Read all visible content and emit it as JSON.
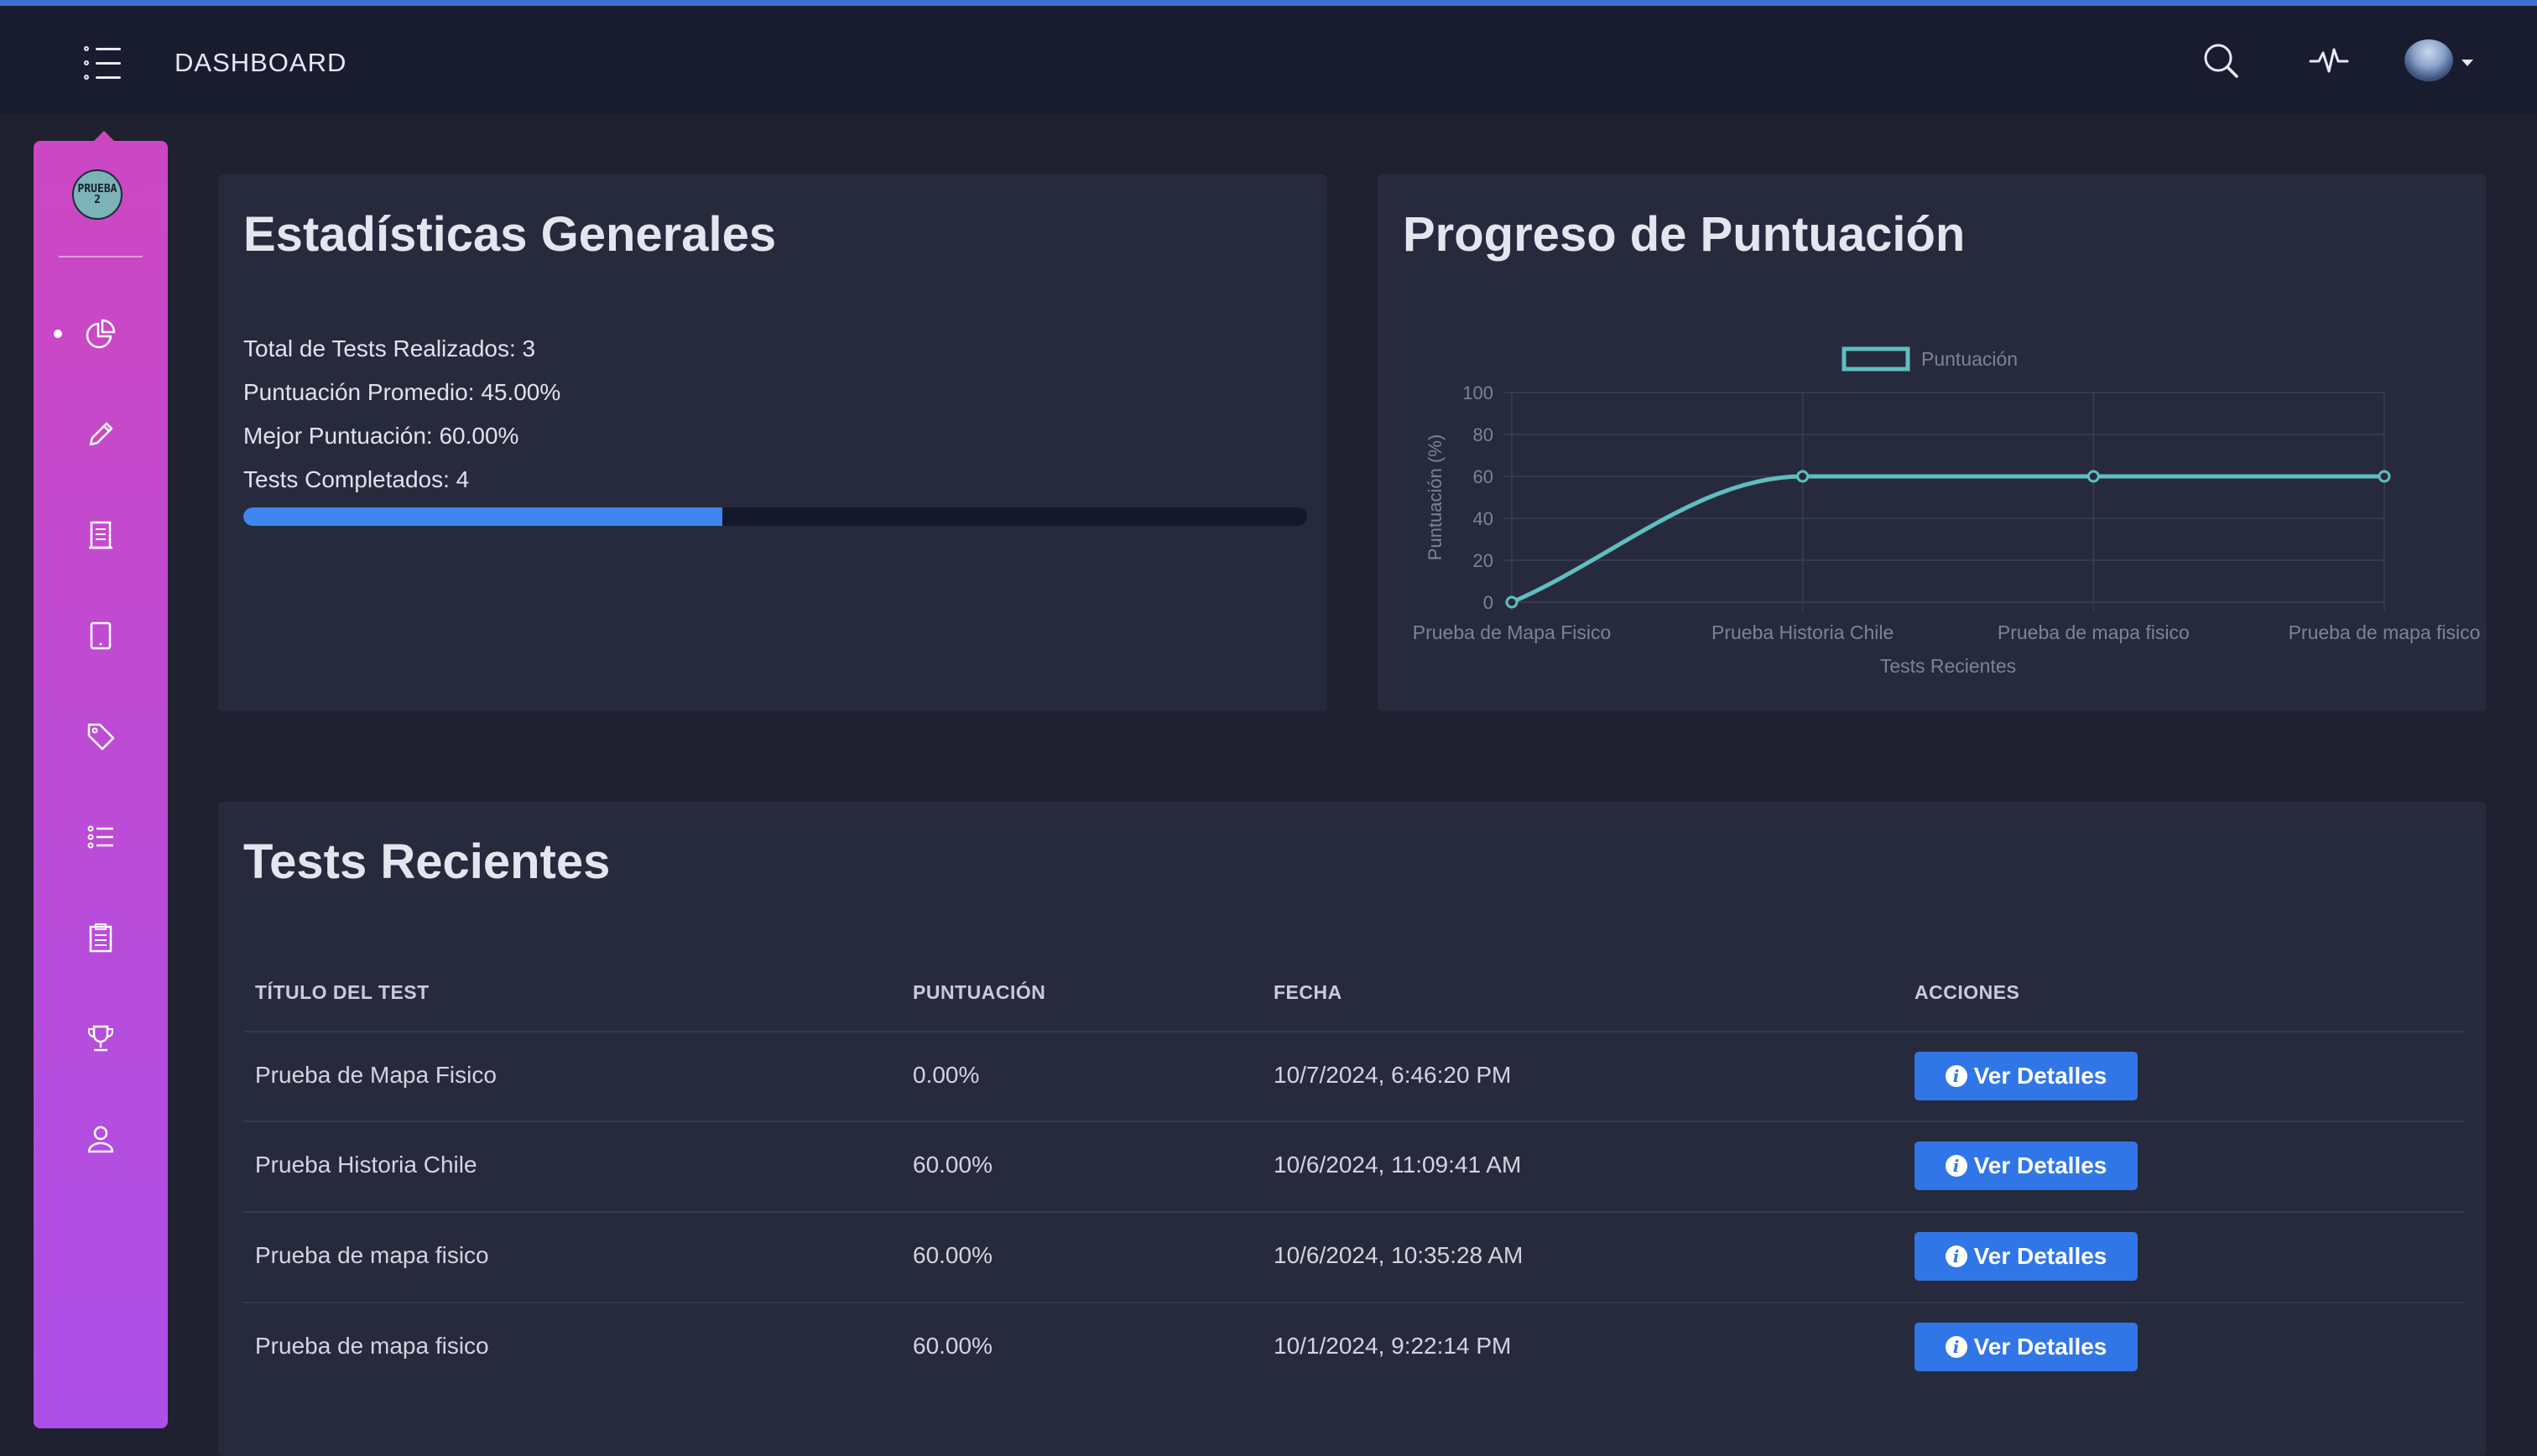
{
  "header": {
    "title": "DASHBOARD",
    "icons": [
      "menu-icon",
      "search-icon",
      "activity-icon",
      "avatar"
    ]
  },
  "sidebar": {
    "logo_text": "PRUEBA 2",
    "active_index": 0,
    "items": [
      {
        "icon": "pie-chart-icon"
      },
      {
        "icon": "pencil-icon"
      },
      {
        "icon": "document-icon"
      },
      {
        "icon": "tablet-icon"
      },
      {
        "icon": "tag-icon"
      },
      {
        "icon": "list-icon"
      },
      {
        "icon": "clipboard-icon"
      },
      {
        "icon": "trophy-icon"
      },
      {
        "icon": "user-icon"
      }
    ]
  },
  "stats": {
    "title": "Estadísticas Generales",
    "total": "Total de Tests Realizados: 3",
    "average": "Puntuación Promedio: 45.00%",
    "best": "Mejor Puntuación: 60.00%",
    "completed": "Tests Completados: 4",
    "progress_fraction": 0.45,
    "progress_color": "#3d86f0"
  },
  "chart_card": {
    "title": "Progreso de Puntuación"
  },
  "chart_data": {
    "type": "line",
    "categories": [
      "Prueba de Mapa Fisico",
      "Prueba Historia Chile",
      "Prueba de mapa fisico",
      "Prueba de mapa fisico"
    ],
    "series": [
      {
        "name": "Puntuación",
        "values": [
          0,
          60,
          60,
          60
        ],
        "color": "#5fbfbd"
      }
    ],
    "xlabel": "Tests Recientes",
    "ylabel": "Puntuación (%)",
    "ylim": [
      0,
      100
    ],
    "yticks": [
      0,
      20,
      40,
      60,
      80,
      100
    ],
    "grid": true,
    "legend": "top"
  },
  "recent": {
    "title": "Tests Recientes",
    "columns": [
      "TÍTULO DEL TEST",
      "PUNTUACIÓN",
      "FECHA",
      "ACCIONES"
    ],
    "button_label": "Ver Detalles",
    "rows": [
      {
        "title": "Prueba de Mapa Fisico",
        "score": "0.00%",
        "date": "10/7/2024, 6:46:20 PM"
      },
      {
        "title": "Prueba Historia Chile",
        "score": "60.00%",
        "date": "10/6/2024, 11:09:41 AM"
      },
      {
        "title": "Prueba de mapa fisico",
        "score": "60.00%",
        "date": "10/6/2024, 10:35:28 AM"
      },
      {
        "title": "Prueba de mapa fisico",
        "score": "60.00%",
        "date": "10/1/2024, 9:22:14 PM"
      }
    ]
  },
  "colors": {
    "background": "#1f2030",
    "card": "#272a3d",
    "topbar": "#191c2e",
    "sidebar_top": "#cd47c2",
    "sidebar_bottom": "#ac4fe8",
    "button": "#3176e6"
  }
}
